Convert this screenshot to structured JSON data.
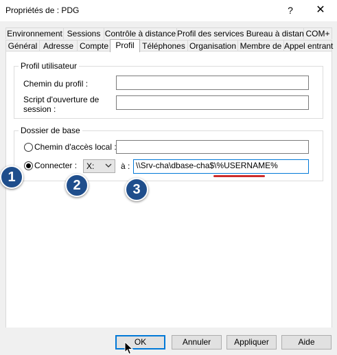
{
  "window": {
    "title": "Propriétés de : PDG",
    "help_label": "?",
    "close_label": "✕"
  },
  "tabs": {
    "row1": [
      "Environnement",
      "Sessions",
      "Contrôle à distance",
      "Profil des services Bureau à distance",
      "COM+"
    ],
    "row2": [
      "Général",
      "Adresse",
      "Compte",
      "Profil",
      "Téléphones",
      "Organisation",
      "Membre de",
      "Appel entrant"
    ],
    "active": "Profil"
  },
  "profile_group": {
    "title": "Profil utilisateur",
    "profile_path_label": "Chemin du profil :",
    "profile_path_value": "",
    "logon_script_label_line1": "Script d'ouverture de",
    "logon_script_label_line2": "session :",
    "logon_script_value": ""
  },
  "home_group": {
    "title": "Dossier de base",
    "local_path_label": "Chemin d'accès local :",
    "local_path_value": "",
    "connect_label": "Connecter :",
    "drive_value": "X:",
    "to_label": "à :",
    "path_value": "\\\\Srv-cha\\dbase-cha$\\%USERNAME%",
    "local_path_selected": false,
    "connect_selected": true
  },
  "annotations": {
    "badge1": "1",
    "badge2": "2",
    "badge3": "3",
    "accent": "#1f4e8c",
    "underline_color": "#cc2b2b"
  },
  "buttons": {
    "ok": "OK",
    "cancel": "Annuler",
    "apply": "Appliquer",
    "help": "Aide"
  }
}
